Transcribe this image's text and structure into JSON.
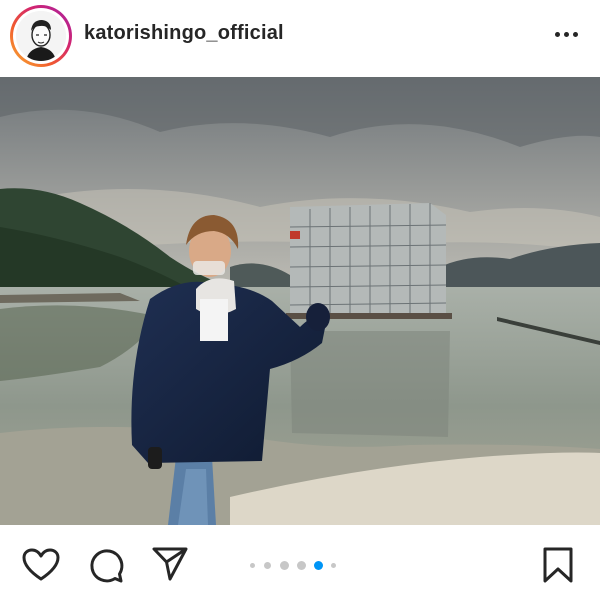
{
  "post": {
    "username": "katorishingo_official",
    "carousel": {
      "total": 6,
      "active": 4
    }
  },
  "icons": {
    "more": "more-horizontal-icon",
    "like": "heart-icon",
    "comment": "comment-bubble-icon",
    "share": "send-paper-plane-icon",
    "save": "bookmark-icon"
  },
  "colors": {
    "text": "#262626",
    "active_dot": "#0095f6",
    "inactive_dot": "#c7c7c7",
    "ring_start": "#f9b234",
    "ring_end": "#a222a8"
  }
}
